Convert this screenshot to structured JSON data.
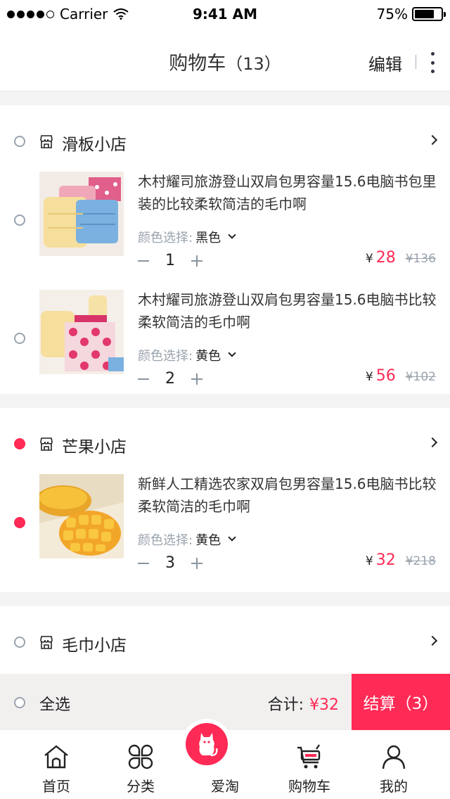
{
  "status_bar": {
    "carrier": "Carrier",
    "time": "9:41 AM",
    "battery": "75%",
    "battery_level": 0.75
  },
  "header": {
    "title": "购物车",
    "count": "（13）",
    "edit_label": "编辑"
  },
  "shops": [
    {
      "name": "滑板小店",
      "checked": false,
      "items": [
        {
          "title": "木村耀司旅游登山双肩包男容量15.6电脑书包里装的比较柔软简洁的毛巾啊",
          "spec_label": "颜色选择:",
          "spec_value": "黑色",
          "qty": "1",
          "currency": "¥",
          "price": "28",
          "old_price": "¥136",
          "checked": false,
          "image": "towels-stack"
        },
        {
          "title": "木村耀司旅游登山双肩包男容量15.6电脑书比较柔软简洁的毛巾啊",
          "spec_label": "颜色选择:",
          "spec_value": "黄色",
          "qty": "2",
          "currency": "¥",
          "price": "56",
          "old_price": "¥102",
          "checked": false,
          "image": "towel-gift-box"
        }
      ]
    },
    {
      "name": "芒果小店",
      "checked": true,
      "items": [
        {
          "title": "新鲜人工精选农家双肩包男容量15.6电脑书比较柔软简洁的毛巾啊",
          "spec_label": "颜色选择:",
          "spec_value": "黄色",
          "qty": "3",
          "currency": "¥",
          "price": "32",
          "old_price": "¥218",
          "checked": true,
          "image": "mango"
        }
      ]
    },
    {
      "name": "毛巾小店",
      "checked": false,
      "items": []
    }
  ],
  "checkout": {
    "select_all": "全选",
    "total_label": "合计:",
    "total_amount": "¥32",
    "button_label": "结算（3）"
  },
  "tabs": [
    {
      "label": "首页",
      "icon": "home-icon"
    },
    {
      "label": "分类",
      "icon": "category-icon"
    },
    {
      "label": "爱淘",
      "icon": "cat-icon"
    },
    {
      "label": "购物车",
      "icon": "cart-icon"
    },
    {
      "label": "我的",
      "icon": "user-icon"
    }
  ],
  "colors": {
    "accent": "#ff2a55",
    "muted": "#9aa3ad"
  }
}
